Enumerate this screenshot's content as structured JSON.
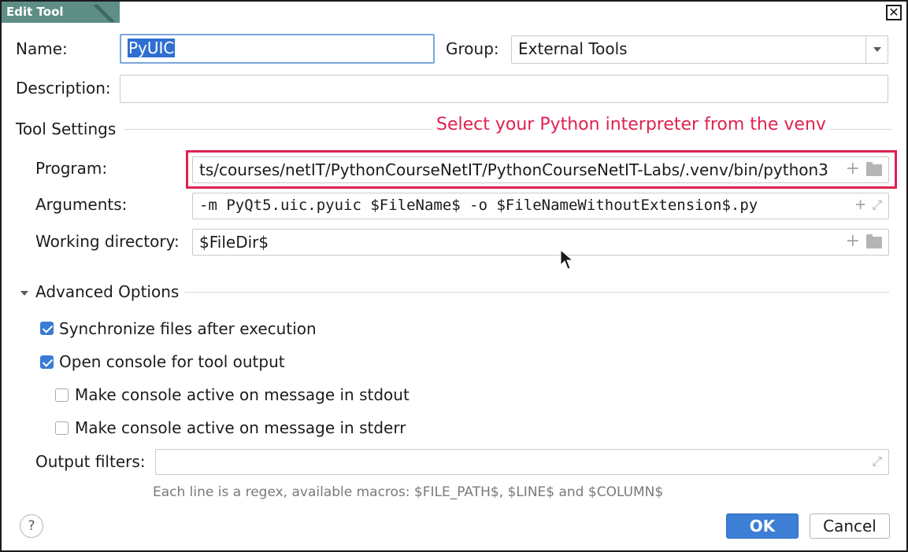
{
  "window": {
    "title": "Edit Tool"
  },
  "form": {
    "name_label": "Name:",
    "name_value": "PyUIC",
    "group_label": "Group:",
    "group_value": "External Tools",
    "description_label": "Description:",
    "description_value": ""
  },
  "tool_settings": {
    "section_title": "Tool Settings",
    "annotation": "Select your Python interpreter from the venv",
    "program_label": "Program:",
    "program_value": "ts/courses/netIT/PythonCourseNetIT/PythonCourseNetIT-Labs/.venv/bin/python3",
    "arguments_label": "Arguments:",
    "arguments_value": "-m PyQt5.uic.pyuic $FileName$ -o $FileNameWithoutExtension$.py",
    "workdir_label": "Working directory:",
    "workdir_value": "$FileDir$"
  },
  "advanced": {
    "section_title": "Advanced Options",
    "sync_label": "Synchronize files after execution",
    "sync_checked": true,
    "console_label": "Open console for tool output",
    "console_checked": true,
    "stdout_label": "Make console active on message in stdout",
    "stdout_checked": false,
    "stderr_label": "Make console active on message in stderr",
    "stderr_checked": false,
    "filters_label": "Output filters:",
    "filters_value": "",
    "filters_hint": "Each line is a regex, available macros: $FILE_PATH$, $LINE$ and $COLUMN$"
  },
  "footer": {
    "help_label": "?",
    "ok_label": "OK",
    "cancel_label": "Cancel"
  },
  "colors": {
    "accent": "#3e7fd6",
    "annotation": "#e0214f",
    "title_tab": "#5e8e86"
  }
}
